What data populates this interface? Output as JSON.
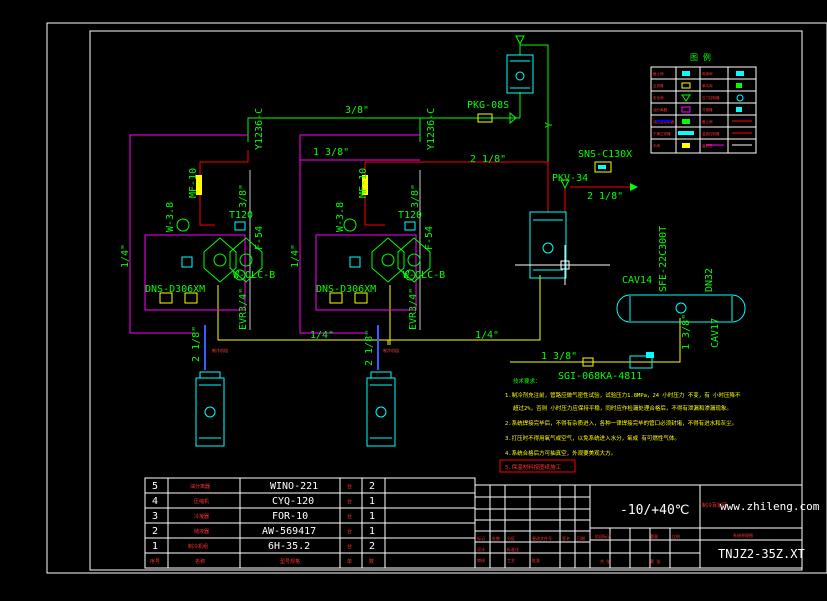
{
  "labels": {
    "pipe_3_8_top": "3/8\"",
    "pkg": "PKG-08S",
    "y1236c_left": "Y1236-C",
    "y1236c_right": "Y1236-C",
    "y_vert": "Y",
    "pipe_1_3_8": "1 3/8\"",
    "pipe_2_1_8": "2 1/8\"",
    "sns": "SNS-C130X",
    "pkv": "PKV-34",
    "pipe_2_1_8_sns": "2 1/8\"",
    "mf_left": "MF-10",
    "mf_right": "MF-10",
    "pipe_3_8_v_left": "3/8\"",
    "pipe_3_8_v_right": "3/8\"",
    "t120_left": "T120",
    "t120_right": "T120",
    "w38_left": "W-3.8",
    "w38_right": "W-3.8",
    "f54_left": "F-54",
    "f54_right": "F-54",
    "olcb_left": "W-OLC-B",
    "olcb_right": "W-OLC-B",
    "dns_left": "DNS-D306XM",
    "dns_right": "DNS-D306XM",
    "evr_left": "EVR3/4\"",
    "evr_right": "EVR3/4\"",
    "pipe_1_4_left": "1/4\"",
    "pipe_1_4_mid": "1/4\"",
    "pipe_1_4_low1": "1/4\"",
    "pipe_1_4_low2": "1/4\"",
    "pipe_2_1_8_low_left": "2 1/8\"",
    "pipe_2_1_8_low_right": "2 1/8\"",
    "cav14": "CAV14",
    "sfe": "SFE-22C300T",
    "dn32": "DN32",
    "cav17": "CAV17",
    "pipe_1_3_8_recv": "1 3/8\"",
    "pipe_1_3_8_sgi": "1 3/8\"",
    "sgi": "SGI-068KA-4811",
    "cn_unit_small": "制冷机组"
  },
  "notes": {
    "title": "技术要求：",
    "items": [
      "1.制冷剂充注前，管路应做气密性试验，试验压力1.8MPa，24 小时压力 不变，有 小时压降不",
      "超过2%，否则 小时压力应保持平稳，同时应作检漏处理合格后，不得有泄漏和渗漏现象。",
      "2.系统焊接完毕后，不得有杂质进入，各种一律焊接完毕的管口必须封堵，不得有进水和灰尘。",
      "3.打压时不得用氧气或空气，以免系统进入水分，氧或 有可燃性气体。",
      "4.系统合格后方可抽真空，外观要美观大方。",
      "5.保温材料按图纸施工"
    ]
  },
  "legend": {
    "title": "图 例",
    "rows": [
      [
        "截止阀",
        "电磁阀",
        "压力表",
        "视液镜"
      ],
      [
        "过滤器",
        "单向阀",
        "热力膨胀阀",
        "温度计"
      ],
      [
        "安全阀",
        "压力控制器",
        "液位计",
        "角阀"
      ],
      [
        "油分离器",
        "冷凝器",
        "储液器",
        "蒸发器"
      ],
      [
        "油压差控制器",
        "截止阀",
        "气液分离器",
        "——"
      ],
      [
        "干燥过滤器",
        "温度控制器",
        "——",
        "——"
      ],
      [
        "手阀",
        "高低压",
        "——",
        "——"
      ]
    ]
  },
  "parts_table": {
    "rows": [
      {
        "no": "5",
        "name": "油分离器",
        "model": "WINO-221",
        "unit": "台",
        "qty": "2"
      },
      {
        "no": "4",
        "name": "压缩机",
        "model": "CYQ-120",
        "unit": "台",
        "qty": "1"
      },
      {
        "no": "3",
        "name": "冷凝器",
        "model": "FOR-10",
        "unit": "台",
        "qty": "1"
      },
      {
        "no": "2",
        "name": "储液器",
        "model": "AW-569417",
        "unit": "台",
        "qty": "1"
      },
      {
        "no": "1",
        "name": "制冷机组",
        "model": "6H-35.2",
        "unit": "台",
        "qty": "2"
      }
    ],
    "header": {
      "no": "序号",
      "name": "名称",
      "model": "型号规格",
      "unit": "单",
      "qty": "数"
    }
  },
  "title_block": {
    "temp": "-10/+40℃",
    "website": "www.zhileng.com",
    "company": "制冷百家网",
    "drawing_name": "系统原理图",
    "drawing_no": "TNJZ2-35Z.XT",
    "cells": [
      "标记",
      "处数",
      "分区",
      "更改文件号",
      "签名",
      "日期",
      "设计",
      "标准化",
      "审核",
      "工艺",
      "批准",
      "阶段标记",
      "重量",
      "比例",
      "共 张",
      "第 张"
    ]
  },
  "colors": {
    "bg": "#000000",
    "frame": "#ffffff",
    "green": "#00ff00",
    "red": "#ff0000",
    "magenta": "#ff00ff",
    "yellow": "#ffff00",
    "cyan": "#00ffff",
    "blue": "#0000ff",
    "white": "#ffffff"
  }
}
